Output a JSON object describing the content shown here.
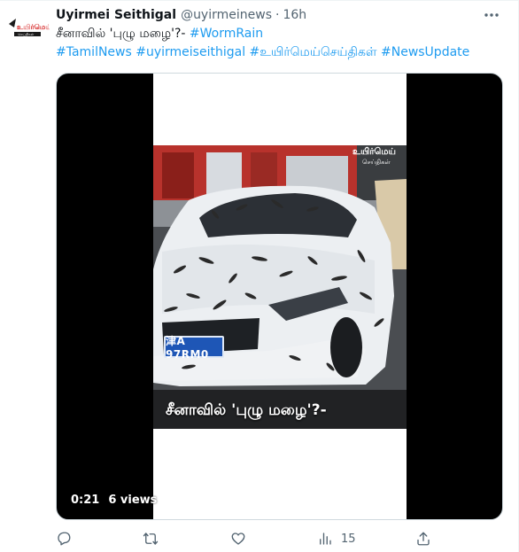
{
  "author": {
    "name": "Uyirmei Seithigal",
    "handle": "@uyirmeinews",
    "separator": "·",
    "time": "16h",
    "avatar_text": "உயிர்மெய்"
  },
  "tweet": {
    "text_main": "சீனாவில் 'புழு மழை'?- ",
    "hashtags_line1": [
      "#WormRain"
    ],
    "hashtags_line2": [
      "#TamilNews",
      "#uyirmeiseithigal",
      "#உயிர்மெய்செய்திகள்",
      "#NewsUpdate"
    ]
  },
  "video": {
    "time": "0:21",
    "views": "6 views",
    "caption": "சீனாவில் 'புழு மழை'?-",
    "watermark_title": "உயிர்மெய்",
    "watermark_sub": "செய்திகள்",
    "plate": "津A 97RM0"
  },
  "actions": {
    "reply_icon": "reply-icon",
    "retweet_icon": "retweet-icon",
    "like_icon": "heart-icon",
    "views_icon": "analytics-icon",
    "views_count": "15",
    "share_icon": "share-icon"
  },
  "colors": {
    "link": "#1d9bf0",
    "secondary_text": "#536471",
    "primary_text": "#0f1419",
    "brand_red": "#d62828"
  }
}
